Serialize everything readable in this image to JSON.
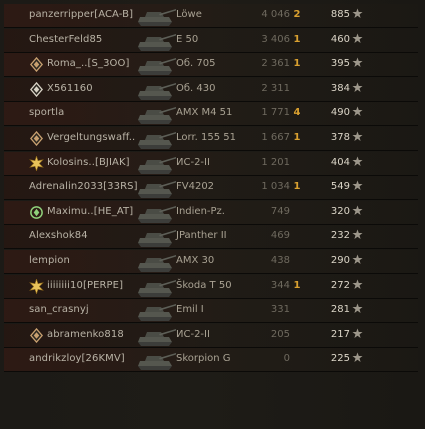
{
  "colors": {
    "name": "#b9b3a6",
    "tank": "#a9a293",
    "damage": "#6f6a5f",
    "kills": "#d9a030",
    "xp": "#dcd6c8",
    "star": "#9c968a"
  },
  "rows": [
    {
      "player": "panzerripper[ACA-B]",
      "tank": "Löwe",
      "damage": "4 046",
      "kills": "2",
      "xp": "885",
      "rank_icon": ""
    },
    {
      "player": "ChesterFeld85",
      "tank": "E 50",
      "damage": "3 406",
      "kills": "1",
      "xp": "460",
      "rank_icon": ""
    },
    {
      "player": "Roma_..[S_3OO]",
      "tank": "Об. 705",
      "damage": "2 361",
      "kills": "1",
      "xp": "395",
      "rank_icon": "bronze-rank-icon"
    },
    {
      "player": "X561160",
      "tank": "Об. 430",
      "damage": "2 311",
      "kills": "",
      "xp": "384",
      "rank_icon": "silver-rank-icon"
    },
    {
      "player": "sportla",
      "tank": "AMX M4 51",
      "damage": "1 771",
      "kills": "4",
      "xp": "490",
      "rank_icon": ""
    },
    {
      "player": "Vergeltungswaff..",
      "tank": "Lorr. 155 51",
      "damage": "1 667",
      "kills": "1",
      "xp": "378",
      "rank_icon": "bronze-rank-icon"
    },
    {
      "player": "Kolosins..[BJIAK]",
      "tank": "ИС-2-II",
      "damage": "1 201",
      "kills": "",
      "xp": "404",
      "rank_icon": "gold-rank-icon"
    },
    {
      "player": "Adrenalin2033[33RS]",
      "tank": "FV4202",
      "damage": "1 034",
      "kills": "1",
      "xp": "549",
      "rank_icon": ""
    },
    {
      "player": "Maximu..[HE_AT]",
      "tank": "Indien-Pz.",
      "damage": "749",
      "kills": "",
      "xp": "320",
      "rank_icon": "green-rank-icon"
    },
    {
      "player": "Alexshok84",
      "tank": "JPanther II",
      "damage": "469",
      "kills": "",
      "xp": "232",
      "rank_icon": ""
    },
    {
      "player": "lempion",
      "tank": "AMX 30",
      "damage": "438",
      "kills": "",
      "xp": "290",
      "rank_icon": ""
    },
    {
      "player": "iiiiiiii10[PERPE]",
      "tank": "Škoda T 50",
      "damage": "344",
      "kills": "1",
      "xp": "272",
      "rank_icon": "gold-rank-icon"
    },
    {
      "player": "san_crasnyj",
      "tank": "Emil I",
      "damage": "331",
      "kills": "",
      "xp": "281",
      "rank_icon": ""
    },
    {
      "player": "abramenko818",
      "tank": "ИС-2-II",
      "damage": "205",
      "kills": "",
      "xp": "217",
      "rank_icon": "bronze-rank-icon"
    },
    {
      "player": "andrikzloy[26KMV]",
      "tank": "Skorpion G",
      "damage": "0",
      "kills": "",
      "xp": "225",
      "rank_icon": ""
    }
  ]
}
